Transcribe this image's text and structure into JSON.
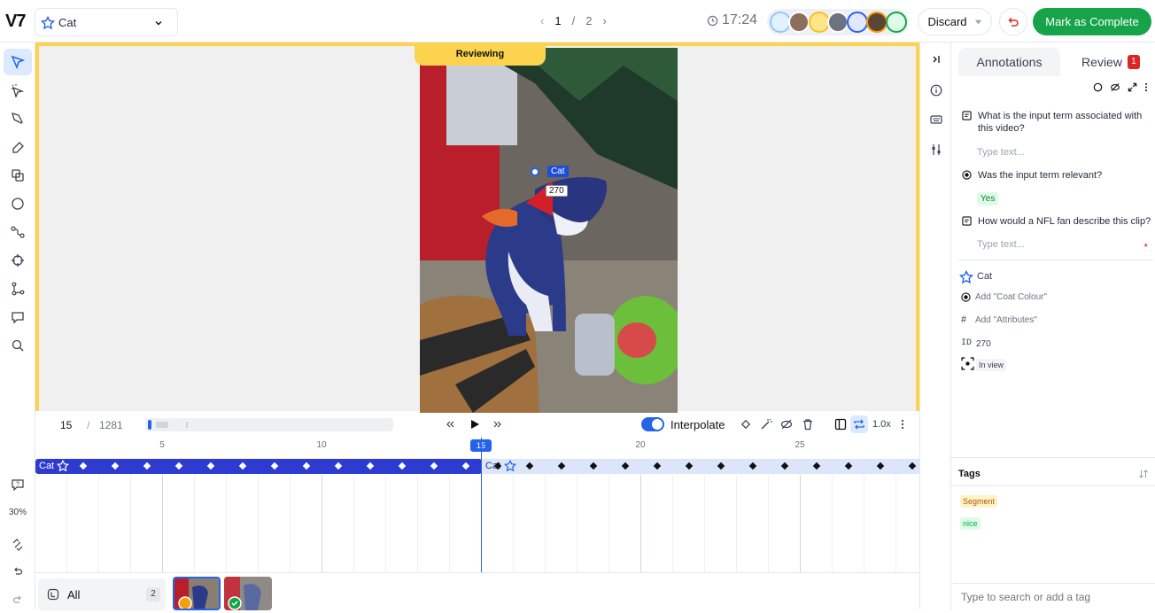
{
  "app": {
    "logo": "V7"
  },
  "class_select": {
    "value": "Cat"
  },
  "pager": {
    "current": "1",
    "separator": "/",
    "total": "2"
  },
  "timer": "17:24",
  "actions": {
    "discard": "Discard",
    "complete": "Mark as Complete"
  },
  "canvas": {
    "stage_label": "Reviewing",
    "annotation": {
      "label": "Cat",
      "id": "270"
    }
  },
  "left_tools": {
    "zoom": "30%"
  },
  "timeline": {
    "current_frame": "15",
    "separator": "/",
    "total_frames": "1281",
    "interpolate_label": "Interpolate",
    "speed": "1.0x",
    "ruler_labels": [
      "5",
      "10",
      "15",
      "20",
      "25"
    ],
    "track_label": "Cat",
    "track_label_after": "Cat"
  },
  "series": {
    "all_label": "All",
    "count": "2"
  },
  "panel": {
    "tabs": {
      "annotations": "Annotations",
      "review": "Review",
      "review_badge": "1"
    },
    "questions": [
      {
        "text": "What is the input term associated with this video?",
        "placeholder": "Type text..."
      },
      {
        "text": "Was the input term relevant?",
        "answer": "Yes"
      },
      {
        "text": "How would a NFL fan describe this clip?",
        "placeholder": "Type text...",
        "required_mark": "*"
      }
    ],
    "class_name": "Cat",
    "add_coat_colour": "Add \"Coat Colour\"",
    "add_attributes": "Add \"Attributes\"",
    "id_prefix": "ID",
    "id_value": "270",
    "in_view": "In view",
    "tags_header": "Tags",
    "tags": [
      "Segment",
      "nice"
    ],
    "tag_placeholder": "Type to search or add a tag"
  },
  "colors": {
    "accent": "#2563eb",
    "review_border": "#fcd34d",
    "complete": "#16a34a",
    "track": "#2e3bd1"
  }
}
